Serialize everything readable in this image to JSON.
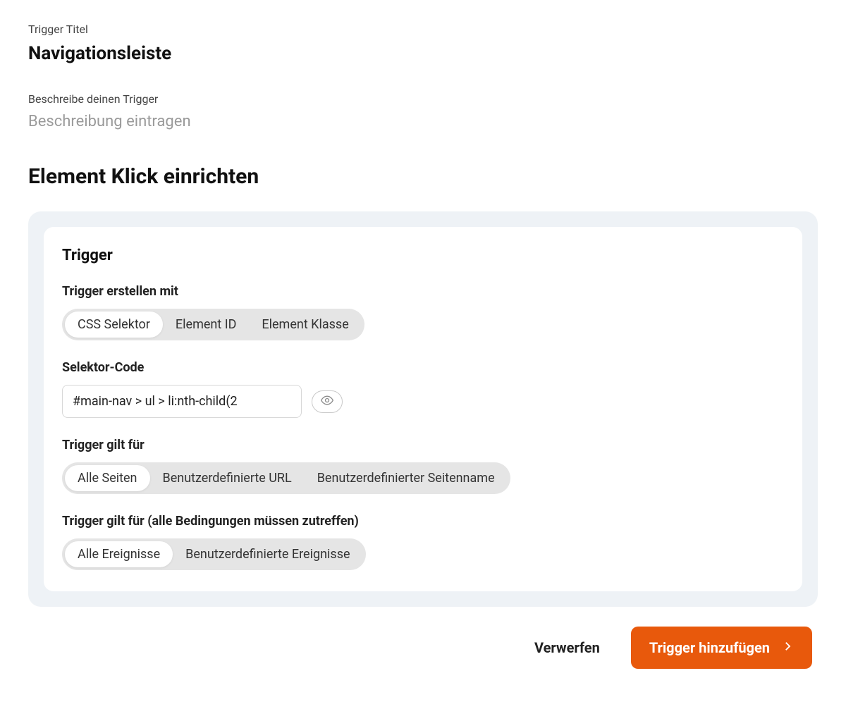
{
  "header": {
    "title_label": "Trigger Titel",
    "title_value": "Navigationsleiste",
    "description_label": "Beschreibe deinen Trigger",
    "description_placeholder": "Beschreibung eintragen"
  },
  "section_title": "Element Klick einrichten",
  "card": {
    "heading": "Trigger",
    "create_with": {
      "label": "Trigger erstellen mit",
      "options": [
        "CSS Selektor",
        "Element ID",
        "Element Klasse"
      ],
      "selected_index": 0
    },
    "selector_code": {
      "label": "Selektor-Code",
      "value": "#main-nav > ul > li:nth-child(2"
    },
    "applies_to_pages": {
      "label": "Trigger gilt für",
      "options": [
        "Alle Seiten",
        "Benutzerdefinierte URL",
        "Benutzerdefinierter Seitenname"
      ],
      "selected_index": 0
    },
    "applies_to_events": {
      "label": "Trigger gilt für (alle Bedingungen müssen zutreffen)",
      "options": [
        "Alle Ereignisse",
        "Benutzerdefinierte Ereignisse"
      ],
      "selected_index": 0
    }
  },
  "footer": {
    "discard_label": "Verwerfen",
    "submit_label": "Trigger hinzufügen"
  }
}
